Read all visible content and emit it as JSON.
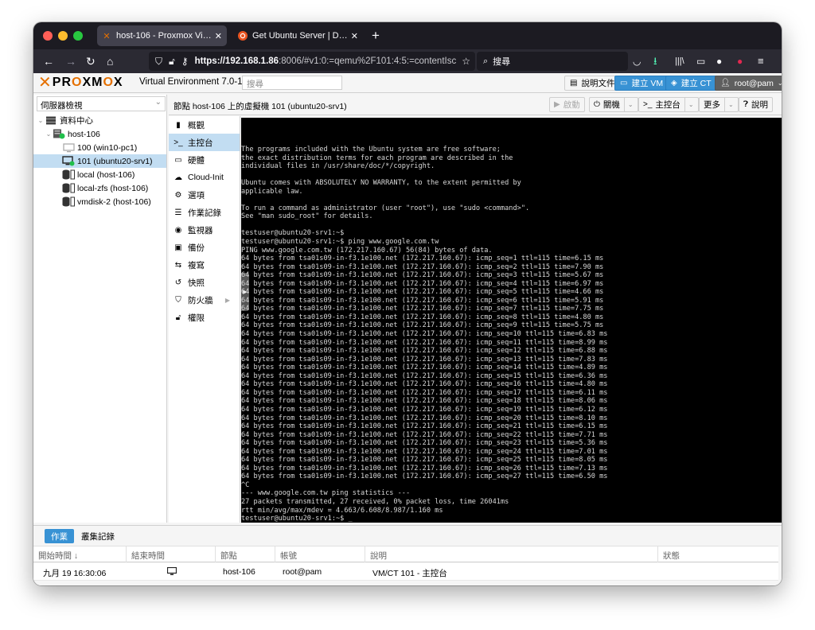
{
  "browser": {
    "tabs": [
      {
        "label": "host-106 - Proxmox Virtual Envi",
        "favicon": "proxmox-icon",
        "active": true
      },
      {
        "label": "Get Ubuntu Server | Download |",
        "favicon": "ubuntu-icon",
        "active": false
      }
    ],
    "url_host": "https://192.168.1.86",
    "url_rest": ":8006/#v1:0:=qemu%2F101:4:5:=contentIsc",
    "search_placeholder": "搜尋"
  },
  "pve": {
    "version": "Virtual Environment 7.0-11",
    "search_placeholder": "搜尋",
    "header_buttons": {
      "docs": "說明文件",
      "create_vm": "建立 VM",
      "create_ct": "建立 CT",
      "user": "root@pam"
    },
    "view_selector": "伺服器檢視",
    "tree": [
      {
        "label": "資料中心",
        "level": 0,
        "icon": "datacenter-icon"
      },
      {
        "label": "host-106",
        "level": 1,
        "icon": "node-icon"
      },
      {
        "label": "100 (win10-pc1)",
        "level": 2,
        "icon": "vm-stopped-icon"
      },
      {
        "label": "101 (ubuntu20-srv1)",
        "level": 2,
        "icon": "vm-running-icon",
        "selected": true
      },
      {
        "label": "local (host-106)",
        "level": 2,
        "icon": "storage-icon"
      },
      {
        "label": "local-zfs (host-106)",
        "level": 2,
        "icon": "storage-icon"
      },
      {
        "label": "vmdisk-2 (host-106)",
        "level": 2,
        "icon": "storage-icon"
      }
    ],
    "panel_title": "節點 host-106 上的虛擬機 101 (ubuntu20-srv1)",
    "toolbar": {
      "start": "啟動",
      "shutdown": "關機",
      "console": "主控台",
      "more": "更多",
      "help": "說明"
    },
    "menu": [
      {
        "label": "概觀",
        "icon": "book-icon"
      },
      {
        "label": "主控台",
        "icon": "terminal-icon",
        "selected": true
      },
      {
        "label": "硬體",
        "icon": "desktop-icon"
      },
      {
        "label": "Cloud-Init",
        "icon": "cloud-icon"
      },
      {
        "label": "選項",
        "icon": "gear-icon"
      },
      {
        "label": "作業記錄",
        "icon": "list-icon"
      },
      {
        "label": "監視器",
        "icon": "eye-icon"
      },
      {
        "label": "備份",
        "icon": "floppy-icon"
      },
      {
        "label": "複寫",
        "icon": "retweet-icon"
      },
      {
        "label": "快照",
        "icon": "history-icon"
      },
      {
        "label": "防火牆",
        "icon": "shield-icon",
        "has_submenu": true
      },
      {
        "label": "權限",
        "icon": "unlock-icon"
      }
    ],
    "console_lines": [
      "The programs included with the Ubuntu system are free software;",
      "the exact distribution terms for each program are described in the",
      "individual files in /usr/share/doc/*/copyright.",
      "",
      "Ubuntu comes with ABSOLUTELY NO WARRANTY, to the extent permitted by",
      "applicable law.",
      "",
      "To run a command as administrator (user \"root\"), use \"sudo <command>\".",
      "See \"man sudo_root\" for details.",
      "",
      "testuser@ubuntu20-srv1:~$",
      "testuser@ubuntu20-srv1:~$ ping www.google.com.tw",
      "PING www.google.com.tw (172.217.160.67) 56(84) bytes of data.",
      "64 bytes from tsa01s09-in-f3.1e100.net (172.217.160.67): icmp_seq=1 ttl=115 time=6.15 ms",
      "64 bytes from tsa01s09-in-f3.1e100.net (172.217.160.67): icmp_seq=2 ttl=115 time=7.90 ms",
      "64 bytes from tsa01s09-in-f3.1e100.net (172.217.160.67): icmp_seq=3 ttl=115 time=5.67 ms",
      "64 bytes from tsa01s09-in-f3.1e100.net (172.217.160.67): icmp_seq=4 ttl=115 time=6.97 ms",
      "64 bytes from tsa01s09-in-f3.1e100.net (172.217.160.67): icmp_seq=5 ttl=115 time=4.66 ms",
      "64 bytes from tsa01s09-in-f3.1e100.net (172.217.160.67): icmp_seq=6 ttl=115 time=5.91 ms",
      "64 bytes from tsa01s09-in-f3.1e100.net (172.217.160.67): icmp_seq=7 ttl=115 time=7.75 ms",
      "64 bytes from tsa01s09-in-f3.1e100.net (172.217.160.67): icmp_seq=8 ttl=115 time=4.80 ms",
      "64 bytes from tsa01s09-in-f3.1e100.net (172.217.160.67): icmp_seq=9 ttl=115 time=5.75 ms",
      "64 bytes from tsa01s09-in-f3.1e100.net (172.217.160.67): icmp_seq=10 ttl=115 time=6.83 ms",
      "64 bytes from tsa01s09-in-f3.1e100.net (172.217.160.67): icmp_seq=11 ttl=115 time=8.99 ms",
      "64 bytes from tsa01s09-in-f3.1e100.net (172.217.160.67): icmp_seq=12 ttl=115 time=6.88 ms",
      "64 bytes from tsa01s09-in-f3.1e100.net (172.217.160.67): icmp_seq=13 ttl=115 time=7.83 ms",
      "64 bytes from tsa01s09-in-f3.1e100.net (172.217.160.67): icmp_seq=14 ttl=115 time=4.89 ms",
      "64 bytes from tsa01s09-in-f3.1e100.net (172.217.160.67): icmp_seq=15 ttl=115 time=6.36 ms",
      "64 bytes from tsa01s09-in-f3.1e100.net (172.217.160.67): icmp_seq=16 ttl=115 time=4.80 ms",
      "64 bytes from tsa01s09-in-f3.1e100.net (172.217.160.67): icmp_seq=17 ttl=115 time=6.11 ms",
      "64 bytes from tsa01s09-in-f3.1e100.net (172.217.160.67): icmp_seq=18 ttl=115 time=8.06 ms",
      "64 bytes from tsa01s09-in-f3.1e100.net (172.217.160.67): icmp_seq=19 ttl=115 time=6.12 ms",
      "64 bytes from tsa01s09-in-f3.1e100.net (172.217.160.67): icmp_seq=20 ttl=115 time=8.10 ms",
      "64 bytes from tsa01s09-in-f3.1e100.net (172.217.160.67): icmp_seq=21 ttl=115 time=6.15 ms",
      "64 bytes from tsa01s09-in-f3.1e100.net (172.217.160.67): icmp_seq=22 ttl=115 time=7.71 ms",
      "64 bytes from tsa01s09-in-f3.1e100.net (172.217.160.67): icmp_seq=23 ttl=115 time=5.36 ms",
      "64 bytes from tsa01s09-in-f3.1e100.net (172.217.160.67): icmp_seq=24 ttl=115 time=7.01 ms",
      "64 bytes from tsa01s09-in-f3.1e100.net (172.217.160.67): icmp_seq=25 ttl=115 time=8.05 ms",
      "64 bytes from tsa01s09-in-f3.1e100.net (172.217.160.67): icmp_seq=26 ttl=115 time=7.13 ms",
      "64 bytes from tsa01s09-in-f3.1e100.net (172.217.160.67): icmp_seq=27 ttl=115 time=6.50 ms",
      "^C",
      "--- www.google.com.tw ping statistics ---",
      "27 packets transmitted, 27 received, 0% packet loss, time 26041ms",
      "rtt min/avg/max/mdev = 4.663/6.608/8.987/1.160 ms",
      "testuser@ubuntu20-srv1:~$ _"
    ],
    "bottom": {
      "tabs": [
        "作業",
        "叢集記錄"
      ],
      "columns": [
        "開始時間 ↓",
        "結束時間",
        "節點",
        "帳號",
        "說明",
        "狀態"
      ],
      "rows": [
        {
          "start": "九月 19 16:30:06",
          "end_icon": "monitor-icon",
          "node": "host-106",
          "user": "root@pam",
          "desc": "VM/CT 101 - 主控台",
          "status": ""
        }
      ]
    }
  },
  "colors": {
    "accent_orange": "#e57000",
    "selection_blue": "#c2ddf2",
    "button_blue": "#3892d4"
  }
}
